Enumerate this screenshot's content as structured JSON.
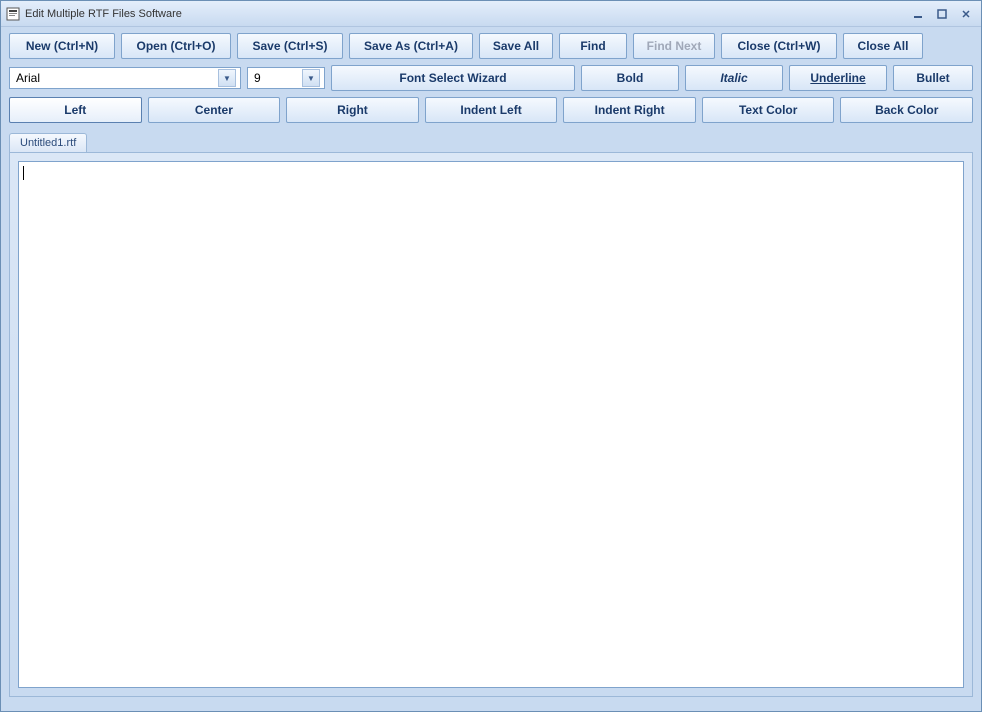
{
  "window": {
    "title": "Edit Multiple RTF Files Software"
  },
  "toolbar1": {
    "new": "New (Ctrl+N)",
    "open": "Open (Ctrl+O)",
    "save": "Save (Ctrl+S)",
    "saveAs": "Save As (Ctrl+A)",
    "saveAll": "Save All",
    "find": "Find",
    "findNext": "Find Next",
    "close": "Close (Ctrl+W)",
    "closeAll": "Close All"
  },
  "toolbar2": {
    "fontName": "Arial",
    "fontSize": "9",
    "fontWizard": "Font Select Wizard",
    "bold": "Bold",
    "italic": "Italic",
    "underline": "Underline",
    "bullet": "Bullet"
  },
  "toolbar3": {
    "left": "Left",
    "center": "Center",
    "right": "Right",
    "indentLeft": "Indent Left",
    "indentRight": "Indent Right",
    "textColor": "Text Color",
    "backColor": "Back Color"
  },
  "tabs": [
    {
      "label": "Untitled1.rtf"
    }
  ]
}
